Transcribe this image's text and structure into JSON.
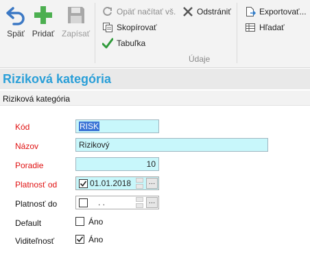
{
  "ribbon": {
    "back_label": "Späť",
    "add_label": "Pridať",
    "save_label": "Zapísať",
    "reload_label": "Opäť načítať vš.",
    "copy_label": "Skopírovať",
    "table_label": "Tabuľka",
    "remove_label": "Odstrániť",
    "export_label": "Exportovať...",
    "find_label": "Hľadať",
    "group_label": "Údaje"
  },
  "page": {
    "title": "Riziková kategória",
    "subtitle": "Riziková kategória"
  },
  "form": {
    "code_label": "Kód",
    "code_value": "RISK",
    "name_label": "Názov",
    "name_value": "Rizikový",
    "order_label": "Poradie",
    "order_value": "10",
    "valid_from_label": "Platnosť od",
    "valid_from_value": "01.01.2018",
    "valid_to_label": "Platnosť do",
    "valid_to_value": ". .",
    "default_label": "Default",
    "default_text": "Áno",
    "visibility_label": "Viditeľnosť",
    "visibility_text": "Áno"
  },
  "state": {
    "valid_from_checked": true,
    "valid_to_checked": false,
    "default_checked": false,
    "visibility_checked": true
  },
  "colors": {
    "accent": "#2a9fd8",
    "required": "#e01010",
    "input_bg": "#c8f7fb",
    "add_green": "#4caf50"
  }
}
